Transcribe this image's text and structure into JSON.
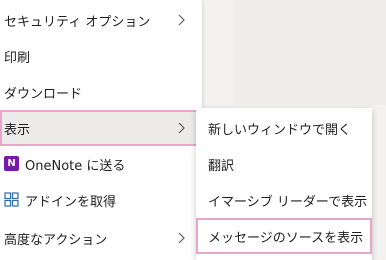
{
  "context_menu": {
    "items": [
      {
        "label": "セキュリティ オプション",
        "has_submenu": true
      },
      {
        "label": "印刷",
        "has_submenu": false
      },
      {
        "label": "ダウンロード",
        "has_submenu": false
      },
      {
        "label": "表示",
        "has_submenu": true,
        "state": "hovered"
      },
      {
        "label": "OneNote に送る",
        "has_submenu": false,
        "icon": "onenote-icon"
      },
      {
        "label": "アドインを取得",
        "has_submenu": false,
        "icon": "addin-grid-icon"
      },
      {
        "label": "高度なアクション",
        "has_submenu": true
      }
    ]
  },
  "submenu": {
    "items": [
      {
        "label": "新しいウィンドウで開く"
      },
      {
        "label": "翻訳"
      },
      {
        "label": "イマーシブ リーダーで表示"
      },
      {
        "label": "メッセージのソースを表示",
        "state": "highlighted"
      }
    ]
  },
  "icons": {
    "onenote_glyph": "N"
  },
  "colors": {
    "highlight_border": "#e7a6c8",
    "hover_bg": "#edebe9",
    "onenote": "#7719aa",
    "addin": "#2b6cb0"
  }
}
